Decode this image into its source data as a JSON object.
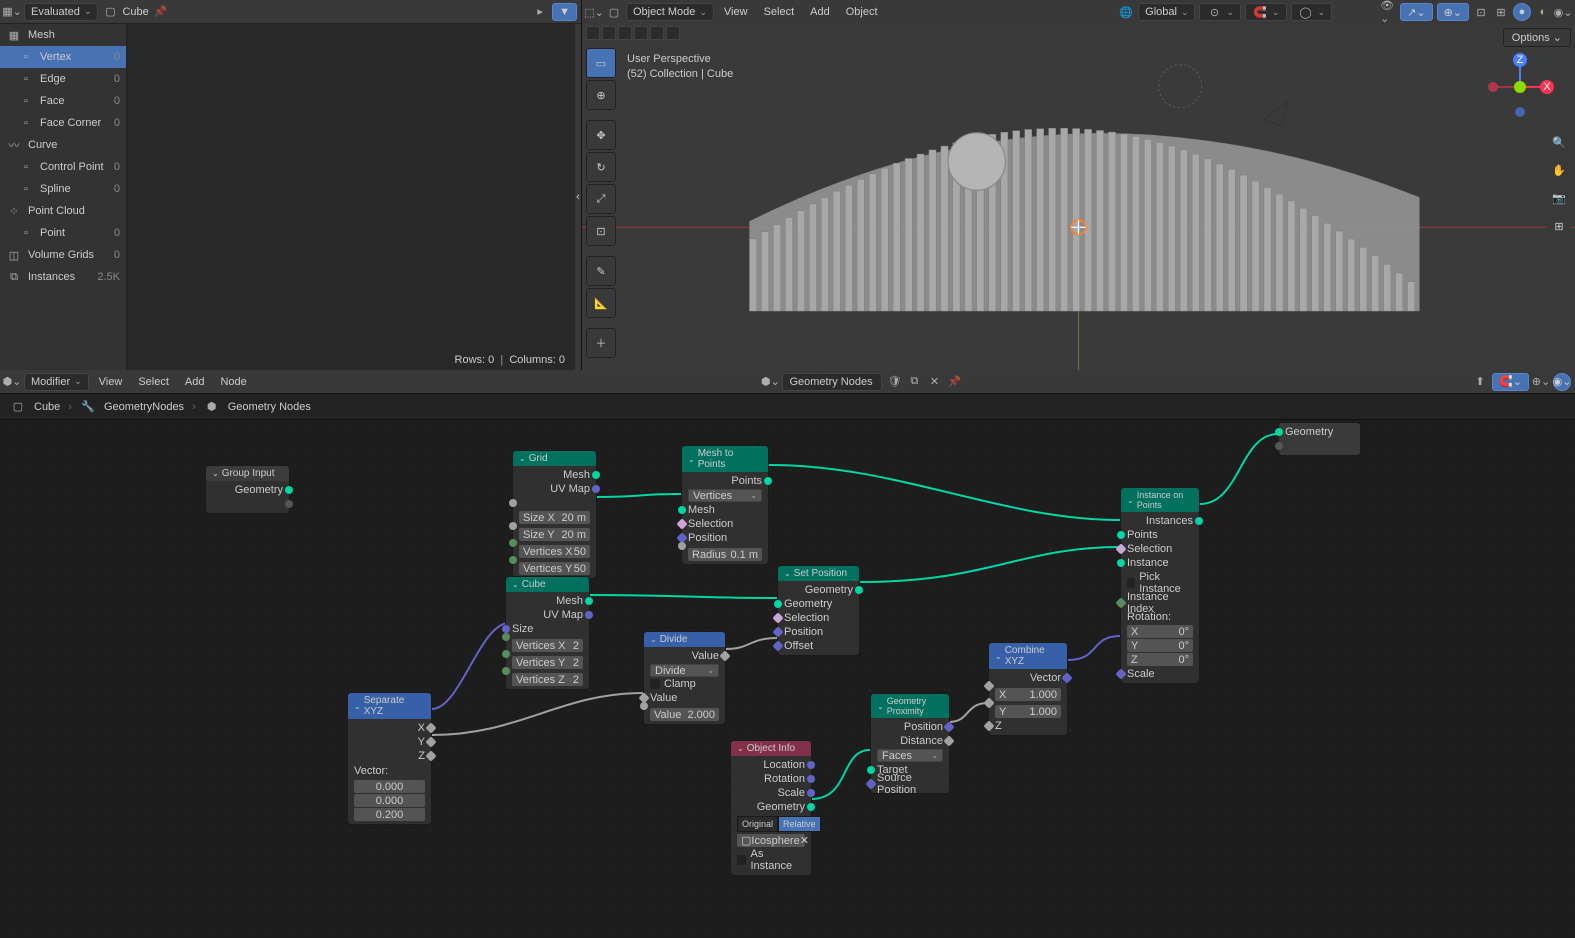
{
  "spreadsheet": {
    "mode": "Evaluated",
    "object": "Cube",
    "tree": [
      {
        "label": "Mesh",
        "icon": "▦",
        "children": [
          {
            "label": "Vertex",
            "count": "0",
            "sel": true
          },
          {
            "label": "Edge",
            "count": "0"
          },
          {
            "label": "Face",
            "count": "0"
          },
          {
            "label": "Face Corner",
            "count": "0"
          }
        ]
      },
      {
        "label": "Curve",
        "icon": "〰",
        "children": [
          {
            "label": "Control Point",
            "count": "0"
          },
          {
            "label": "Spline",
            "count": "0"
          }
        ]
      },
      {
        "label": "Point Cloud",
        "icon": "⁘",
        "children": [
          {
            "label": "Point",
            "count": "0"
          }
        ]
      },
      {
        "label": "Volume Grids",
        "count": "0",
        "icon": "◫"
      },
      {
        "label": "Instances",
        "count": "2.5K",
        "icon": "⧉"
      }
    ],
    "footer_rows": "Rows: 0",
    "footer_cols": "Columns: 0"
  },
  "viewport": {
    "mode": "Object Mode",
    "menus": [
      "View",
      "Select",
      "Add",
      "Object"
    ],
    "orientation": "Global",
    "info_line1": "User Perspective",
    "info_line2": "(52) Collection | Cube",
    "options": "Options"
  },
  "nodeEditor": {
    "mode": "Modifier",
    "menus": [
      "View",
      "Select",
      "Add",
      "Node"
    ],
    "treeName": "Geometry Nodes",
    "breadcrumb": [
      "Cube",
      "GeometryNodes",
      "Geometry Nodes"
    ]
  },
  "nodes": {
    "groupInput": {
      "title": "Group Input",
      "outs": [
        "Geometry"
      ]
    },
    "grid": {
      "title": "Grid",
      "outs": [
        "Mesh",
        "UV Map"
      ],
      "fields": [
        [
          "Size X",
          "20 m"
        ],
        [
          "Size Y",
          "20 m"
        ],
        [
          "Vertices X",
          "50"
        ],
        [
          "Vertices Y",
          "50"
        ]
      ]
    },
    "cube": {
      "title": "Cube",
      "outs": [
        "Mesh",
        "UV Map"
      ],
      "ins": [
        "Size"
      ],
      "fields": [
        [
          "Vertices X",
          "2"
        ],
        [
          "Vertices Y",
          "2"
        ],
        [
          "Vertices Z",
          "2"
        ]
      ]
    },
    "sepxyz": {
      "title": "Separate XYZ",
      "outs": [
        "X",
        "Y",
        "Z"
      ],
      "vec_label": "Vector:",
      "vec": [
        "0.000",
        "0.000",
        "0.200"
      ]
    },
    "divide": {
      "title": "Divide",
      "outs": [
        "Value"
      ],
      "op": "Divide",
      "clamp": "Clamp",
      "ins": [
        "Value"
      ],
      "field": [
        "Value",
        "2.000"
      ]
    },
    "meshToPoints": {
      "title": "Mesh to Points",
      "outs": [
        "Points"
      ],
      "mode": "Vertices",
      "ins": [
        "Mesh",
        "Selection",
        "Position"
      ],
      "field": [
        "Radius",
        "0.1 m"
      ]
    },
    "setPosition": {
      "title": "Set Position",
      "outs": [
        "Geometry"
      ],
      "ins": [
        "Geometry",
        "Selection",
        "Position",
        "Offset"
      ]
    },
    "objectInfo": {
      "title": "Object Info",
      "outs": [
        "Location",
        "Rotation",
        "Scale",
        "Geometry"
      ],
      "btns": [
        "Original",
        "Relative"
      ],
      "obj": "Icosphere",
      "asInstance": "As Instance"
    },
    "geoProx": {
      "title": "Geometry Proximity",
      "outs": [
        "Position",
        "Distance"
      ],
      "mode": "Faces",
      "ins": [
        "Target",
        "Source Position"
      ]
    },
    "combxyz": {
      "title": "Combine XYZ",
      "outs": [
        "Vector"
      ],
      "fields": [
        [
          "X",
          "1.000"
        ],
        [
          "Y",
          "1.000"
        ]
      ],
      "ins": [
        "Z"
      ]
    },
    "instOnPoints": {
      "title": "Instance on Points",
      "outs": [
        "Instances"
      ],
      "ins": [
        "Points",
        "Selection",
        "Instance",
        "Pick Instance",
        "Instance Index"
      ],
      "rot_label": "Rotation:",
      "rot": [
        [
          "X",
          "0°"
        ],
        [
          "Y",
          "0°"
        ],
        [
          "Z",
          "0°"
        ]
      ],
      "scale": "Scale"
    },
    "groupOutput": {
      "title": "Geometry"
    }
  }
}
